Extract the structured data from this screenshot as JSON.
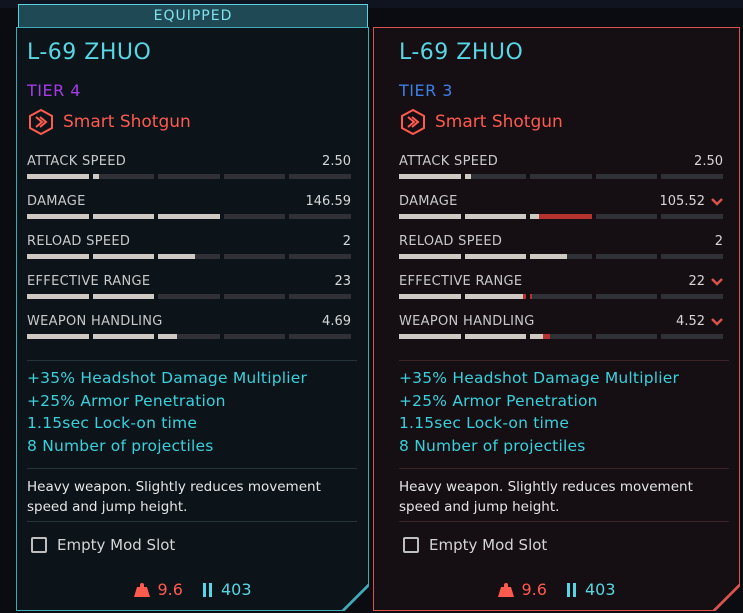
{
  "equipped_label": "EQUIPPED",
  "colors": {
    "cyan": "#58d6e3",
    "red": "#ff5a4e",
    "tier4": "#a53ce6",
    "tier3": "#3c7fe6"
  },
  "left": {
    "name": "L-69 ZHUO",
    "tier": "TIER 4",
    "type": "Smart Shotgun",
    "type_icon": "smart-weapon-icon",
    "stats": [
      {
        "label": "ATTACK SPEED",
        "value": "2.50",
        "fill": 0.22,
        "loss": 0
      },
      {
        "label": "DAMAGE",
        "value": "146.59",
        "fill": 0.6,
        "loss": 0
      },
      {
        "label": "RELOAD SPEED",
        "value": "2",
        "fill": 0.52,
        "loss": 0
      },
      {
        "label": "EFFECTIVE RANGE",
        "value": "23",
        "fill": 0.4,
        "loss": 0
      },
      {
        "label": "WEAPON HANDLING",
        "value": "4.69",
        "fill": 0.46,
        "loss": 0
      }
    ],
    "bonuses": [
      "+35% Headshot Damage Multiplier",
      "+25% Armor Penetration",
      "1.15sec Lock-on time",
      "8 Number of projectiles"
    ],
    "description": "Heavy weapon. Slightly reduces movement speed and jump height.",
    "mod_slot": "Empty Mod Slot",
    "weight": "9.6",
    "ammo": "403"
  },
  "right": {
    "name": "L-69 ZHUO",
    "tier": "TIER 3",
    "type": "Smart Shotgun",
    "type_icon": "smart-weapon-icon",
    "stats": [
      {
        "label": "ATTACK SPEED",
        "value": "2.50",
        "fill": 0.22,
        "loss": 0,
        "down": false
      },
      {
        "label": "DAMAGE",
        "value": "105.52",
        "fill": 0.43,
        "loss": 0.17,
        "down": true
      },
      {
        "label": "RELOAD SPEED",
        "value": "2",
        "fill": 0.52,
        "loss": 0,
        "down": false
      },
      {
        "label": "EFFECTIVE RANGE",
        "value": "22",
        "fill": 0.39,
        "loss": 0.015,
        "down": true
      },
      {
        "label": "WEAPON HANDLING",
        "value": "4.52",
        "fill": 0.44,
        "loss": 0.025,
        "down": true
      }
    ],
    "bonuses": [
      "+35% Headshot Damage Multiplier",
      "+25% Armor Penetration",
      "1.15sec Lock-on time",
      "8 Number of projectiles"
    ],
    "description": "Heavy weapon. Slightly reduces movement speed and jump height.",
    "mod_slot": "Empty Mod Slot",
    "weight": "9.6",
    "ammo": "403"
  }
}
